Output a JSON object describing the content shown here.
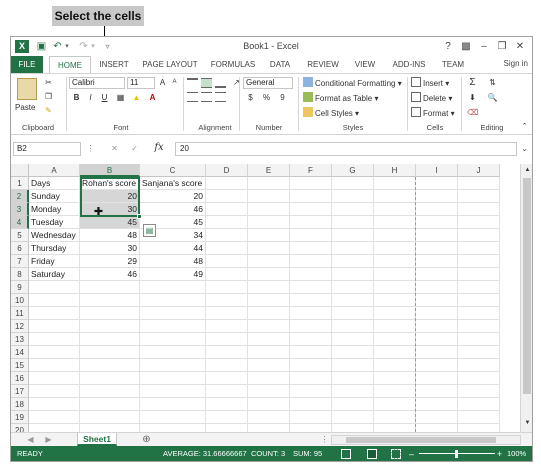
{
  "annotation": {
    "label": "Select the cells"
  },
  "window": {
    "title": "Book1 - Excel",
    "help": "?",
    "sign_in": "Sign in"
  },
  "ribbon_tabs": [
    "FILE",
    "HOME",
    "INSERT",
    "PAGE LAYOUT",
    "FORMULAS",
    "DATA",
    "REVIEW",
    "VIEW",
    "ADD-INS",
    "TEAM"
  ],
  "ribbon": {
    "clipboard": {
      "paste": "Paste",
      "label": "Clipboard"
    },
    "font": {
      "name": "Calibri",
      "size": "11",
      "bold": "B",
      "italic": "I",
      "underline": "U",
      "label": "Font"
    },
    "alignment": {
      "label": "Alignment"
    },
    "number": {
      "format": "General",
      "currency": "$",
      "percent": "%",
      "comma": "9",
      "label": "Number"
    },
    "styles": {
      "conditional": "Conditional Formatting",
      "table": "Format as Table",
      "cell_styles": "Cell Styles",
      "label": "Styles"
    },
    "cells": {
      "insert": "Insert",
      "delete": "Delete",
      "format": "Format",
      "label": "Cells"
    },
    "editing": {
      "label": "Editing"
    }
  },
  "formula_bar": {
    "name_box": "B2",
    "fx": "fx",
    "value": "20"
  },
  "columns": [
    "A",
    "B",
    "C",
    "D",
    "E",
    "F",
    "G",
    "H",
    "I",
    "J"
  ],
  "rows": [
    "1",
    "2",
    "3",
    "4",
    "5",
    "6",
    "7",
    "8",
    "9",
    "10",
    "11",
    "12",
    "13",
    "14",
    "15",
    "16",
    "17",
    "18",
    "19",
    "20"
  ],
  "sheet": {
    "headers": [
      "Days",
      "Rohan's score",
      "Sanjana's score"
    ],
    "data": [
      [
        "Sunday",
        "20",
        "20"
      ],
      [
        "Monday",
        "30",
        "46"
      ],
      [
        "Tuesday",
        "45",
        "45"
      ],
      [
        "Wednesday",
        "48",
        "34"
      ],
      [
        "Thursday",
        "30",
        "44"
      ],
      [
        "Friday",
        "29",
        "48"
      ],
      [
        "Saturday",
        "46",
        "49"
      ]
    ]
  },
  "sheet_tabs": {
    "active": "Sheet1"
  },
  "status_bar": {
    "ready": "READY",
    "average": "AVERAGE: 31.66666667",
    "count": "COUNT: 3",
    "sum": "SUM: 95",
    "zoom": "100%"
  },
  "colors": {
    "excel_green": "#217346",
    "selection_fill": "#d6d6d6"
  }
}
